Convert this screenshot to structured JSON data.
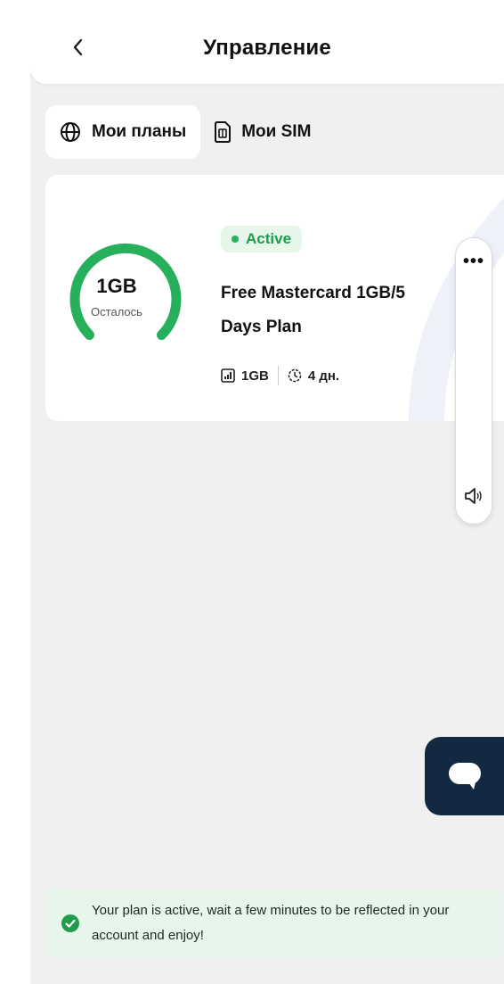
{
  "header": {
    "title": "Управление"
  },
  "tabs": [
    {
      "label": "Мои планы",
      "icon": "globe-icon",
      "active": true
    },
    {
      "label": "Мои SIM",
      "icon": "sim-card-icon",
      "active": false
    }
  ],
  "plan": {
    "status": "Active",
    "name_line1": "Free Mastercard 1GB/5",
    "name_line2": "Days Plan",
    "remaining_value": "1GB",
    "remaining_label": "Осталось",
    "remaining_fraction": 1.0,
    "data_amount": "1GB",
    "days_left": "4 дн."
  },
  "side_panel": {
    "more_label": "•••"
  },
  "toast": {
    "message": "Your plan is active, wait a few minutes to be reflected in your account and enjoy!"
  },
  "colors": {
    "accent_green": "#27b05b",
    "active_badge_bg": "#e6f6ea",
    "chat_button_bg": "#132841",
    "toast_bg": "#e8f5ea"
  }
}
